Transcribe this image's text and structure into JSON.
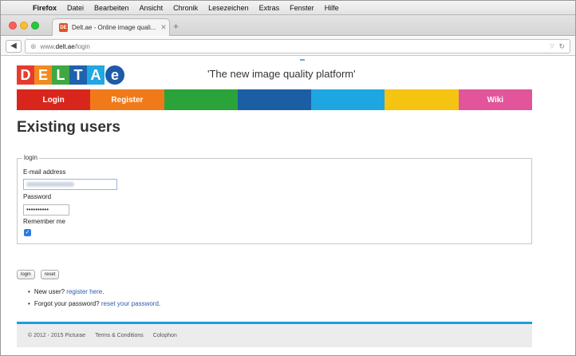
{
  "menubar": {
    "app_name": "Firefox",
    "items": [
      "Datei",
      "Bearbeiten",
      "Ansicht",
      "Chronik",
      "Lesezeichen",
      "Extras",
      "Fenster",
      "Hilfe"
    ]
  },
  "tab": {
    "favicon_text": "DE",
    "title": "Delt.ae - Online image quali..."
  },
  "urlbar": {
    "prefix": "www.",
    "domain": "delt.ae",
    "path": "/login"
  },
  "site": {
    "logo_letters": [
      "D",
      "E",
      "L",
      "T",
      "A",
      "e"
    ],
    "tagline": "'The new image quality platform'",
    "nav": [
      "Login",
      "Register",
      "",
      "",
      "",
      "",
      "Wiki"
    ],
    "nav_colors": [
      "#d9261c",
      "#f07a1a",
      "#2aa33a",
      "#1b5ea3",
      "#1ea6e2",
      "#f5c312",
      "#e2559b"
    ]
  },
  "page": {
    "title": "Existing users",
    "legend": "login",
    "email_label": "E-mail address",
    "password_label": "Password",
    "password_value": "••••••••••",
    "remember_label": "Remember me",
    "remember_checked": true
  },
  "buttons": {
    "login": "login",
    "reset": "reset"
  },
  "links": {
    "new_user_text": "New user?",
    "register_link": "register here",
    "forgot_text": "Forgot your password?",
    "reset_link": "reset your password"
  },
  "footer": {
    "copyright": "© 2012 - 2015 Picturae",
    "terms": "Terms & Conditions",
    "colophon": "Colophon"
  }
}
